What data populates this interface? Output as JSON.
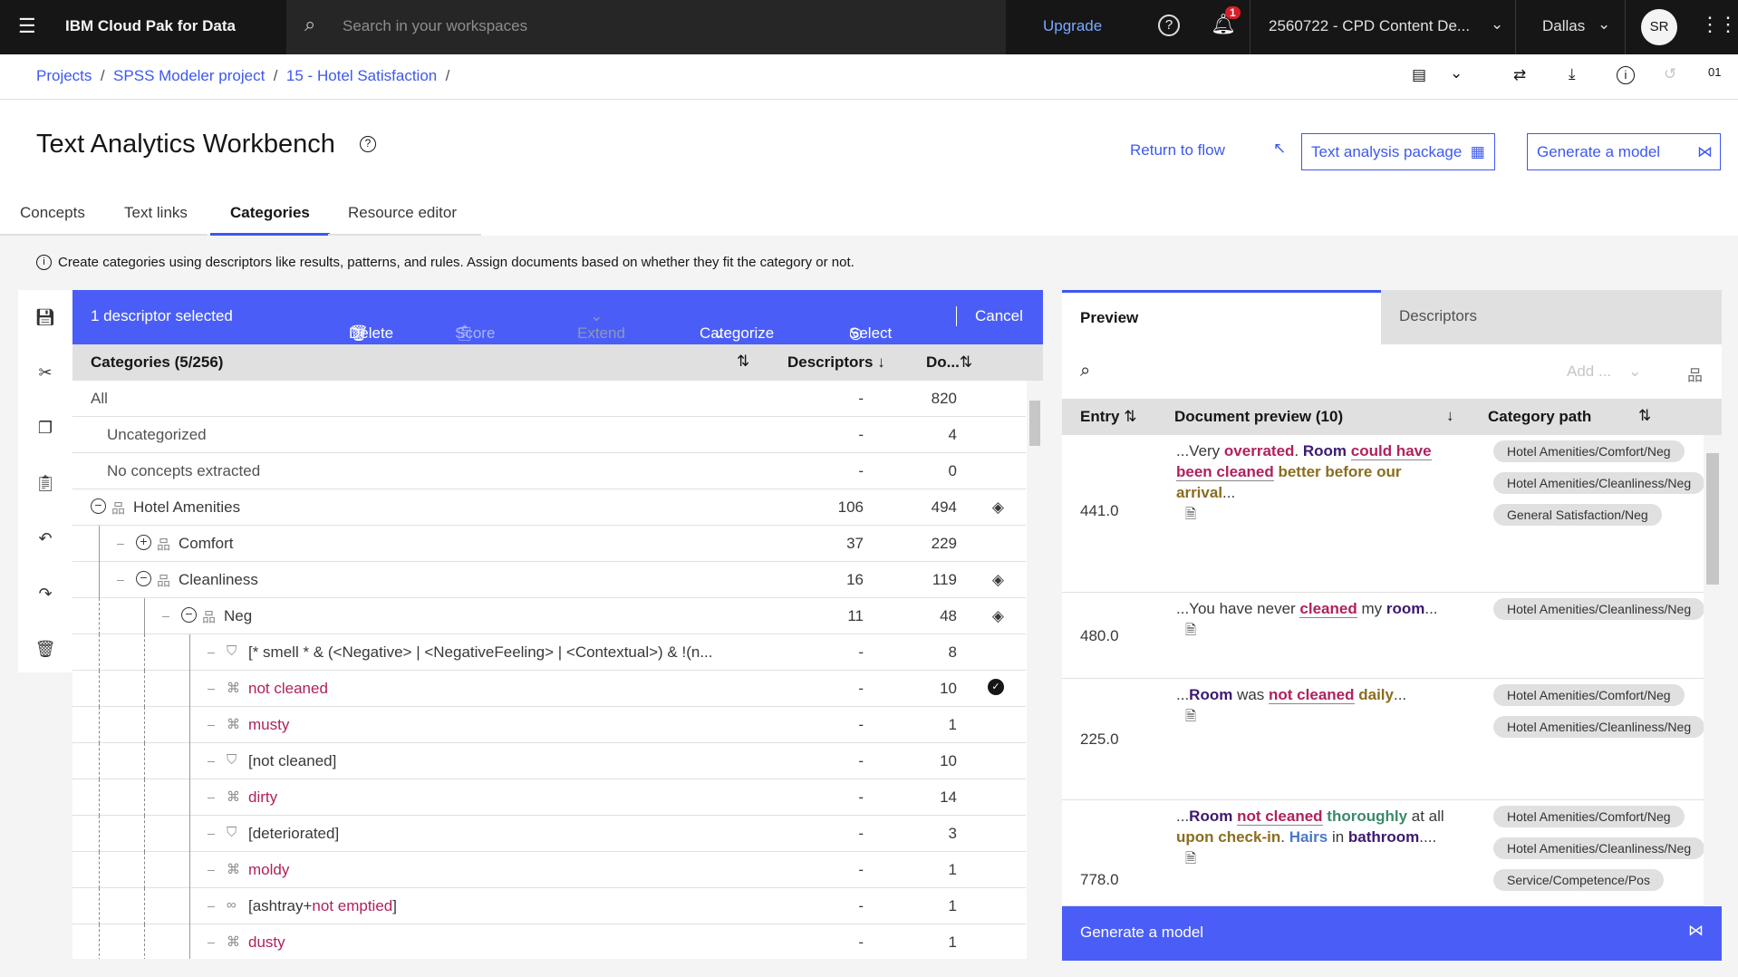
{
  "topbar": {
    "brand": "IBM Cloud Pak for Data",
    "search_placeholder": "Search in your workspaces",
    "upgrade": "Upgrade",
    "notifications": "1",
    "account": "2560722 - CPD Content De...",
    "region": "Dallas",
    "avatar": "SR"
  },
  "breadcrumb": [
    "Projects",
    "SPSS Modeler project",
    "15 - Hotel Satisfaction"
  ],
  "header": {
    "title": "Text Analytics Workbench",
    "return": "Return to flow",
    "package": "Text analysis package",
    "generate": "Generate a model"
  },
  "tabs": [
    "Concepts",
    "Text links",
    "Categories",
    "Resource editor"
  ],
  "info": "Create categories using descriptors like results, patterns, and rules. Assign documents based on whether they fit the category or not.",
  "toolbar": {
    "selected": "1 descriptor selected",
    "delete": "Delete",
    "score": "Score all",
    "extend": "Extend",
    "categorize": "Categorize",
    "select_all": "Select all",
    "cancel": "Cancel"
  },
  "table": {
    "col_categories": "Categories (5/256)",
    "col_descriptors": "Descriptors",
    "col_docs": "Do...",
    "rows": [
      {
        "name": "All",
        "level": 0,
        "type": "plain",
        "desc": "-",
        "docs": "820"
      },
      {
        "name": "Uncategorized",
        "level": 1,
        "type": "plain",
        "desc": "-",
        "docs": "4"
      },
      {
        "name": "No concepts extracted",
        "level": 1,
        "type": "plain",
        "desc": "-",
        "docs": "0"
      },
      {
        "name": "Hotel Amenities",
        "level": 0,
        "type": "cat",
        "toggle": "collapse",
        "desc": "106",
        "docs": "494",
        "mark": "diamond"
      },
      {
        "name": "Comfort",
        "level": 1,
        "type": "cat",
        "toggle": "expand",
        "desc": "37",
        "docs": "229"
      },
      {
        "name": "Cleanliness",
        "level": 1,
        "type": "cat",
        "toggle": "collapse",
        "desc": "16",
        "docs": "119",
        "mark": "diamond"
      },
      {
        "name": "Neg",
        "level": 2,
        "type": "cat",
        "toggle": "collapse",
        "desc": "11",
        "docs": "48",
        "mark": "diamond"
      },
      {
        "name": "[* smell * & (<Negative> | <NegativeFeeling> | <Contextual>) & !(n...",
        "level": 3,
        "type": "rule",
        "desc": "-",
        "docs": "8"
      },
      {
        "name": "not cleaned",
        "level": 3,
        "type": "concept",
        "desc": "-",
        "docs": "10",
        "mark": "check"
      },
      {
        "name": "musty",
        "level": 3,
        "type": "concept",
        "desc": "-",
        "docs": "1"
      },
      {
        "name": "[not cleaned]",
        "level": 3,
        "type": "rule",
        "desc": "-",
        "docs": "10"
      },
      {
        "name": "dirty",
        "level": 3,
        "type": "concept",
        "desc": "-",
        "docs": "14"
      },
      {
        "name": "[deteriorated]",
        "level": 3,
        "type": "rule",
        "desc": "-",
        "docs": "3"
      },
      {
        "name": "moldy",
        "level": 3,
        "type": "concept",
        "desc": "-",
        "docs": "1"
      },
      {
        "name": "[ashtray+not emptied]",
        "level": 3,
        "type": "link",
        "prefix": "[ashtray+",
        "hl": "not emptied",
        "suffix": "]",
        "desc": "-",
        "docs": "1"
      },
      {
        "name": "dusty",
        "level": 3,
        "type": "concept",
        "desc": "-",
        "docs": "1"
      }
    ]
  },
  "preview": {
    "tab_preview": "Preview",
    "tab_descriptors": "Descriptors",
    "add": "Add ...",
    "col_entry": "Entry",
    "col_doc": "Document preview (10)",
    "col_cat": "Category path",
    "generate": "Generate a model",
    "colors": {
      "pink": "#b0215e",
      "purple": "#3c1a6e",
      "olive": "#8a6d1f",
      "green": "#3c8a6a",
      "blue": "#4a78c8",
      "plain": "#393939"
    },
    "docs": [
      {
        "entry": "441.0",
        "segments": [
          [
            "...Very ",
            "plain"
          ],
          [
            "overrated",
            "pink"
          ],
          [
            ". ",
            "plain"
          ],
          [
            "Room ",
            "purple"
          ],
          [
            "could have been cleaned",
            "pink",
            true
          ],
          [
            " better before our arrival",
            "olive"
          ],
          [
            "...",
            "plain"
          ]
        ],
        "cats": [
          "Hotel Amenities/Comfort/Neg",
          "Hotel Amenities/Cleanliness/Neg",
          "General Satisfaction/Neg"
        ]
      },
      {
        "entry": "480.0",
        "segments": [
          [
            "...You have never ",
            "plain"
          ],
          [
            "cleaned",
            "pink",
            true
          ],
          [
            " my ",
            "plain"
          ],
          [
            "room",
            "purple"
          ],
          [
            "...",
            "plain"
          ]
        ],
        "cats": [
          "Hotel Amenities/Cleanliness/Neg"
        ]
      },
      {
        "entry": "225.0",
        "segments": [
          [
            "...",
            "plain"
          ],
          [
            "Room",
            "purple"
          ],
          [
            " was ",
            "plain"
          ],
          [
            "not cleaned",
            "pink",
            true
          ],
          [
            " ",
            "plain"
          ],
          [
            "daily",
            "olive"
          ],
          [
            "...",
            "plain"
          ]
        ],
        "cats": [
          "Hotel Amenities/Comfort/Neg",
          "Hotel Amenities/Cleanliness/Neg"
        ]
      },
      {
        "entry": "778.0",
        "segments": [
          [
            "...",
            "plain"
          ],
          [
            "Room",
            "purple"
          ],
          [
            " ",
            "plain"
          ],
          [
            "not cleaned",
            "pink",
            true
          ],
          [
            " ",
            "plain"
          ],
          [
            "thoroughly",
            "green"
          ],
          [
            " at all ",
            "plain"
          ],
          [
            "upon check-in",
            "olive"
          ],
          [
            ". ",
            "plain"
          ],
          [
            "Hairs",
            "blue"
          ],
          [
            " in ",
            "plain"
          ],
          [
            "bathroom",
            "purple"
          ],
          [
            "....",
            "plain"
          ]
        ],
        "cats": [
          "Hotel Amenities/Comfort/Neg",
          "Hotel Amenities/Cleanliness/Neg",
          "Service/Competence/Pos"
        ]
      }
    ]
  }
}
